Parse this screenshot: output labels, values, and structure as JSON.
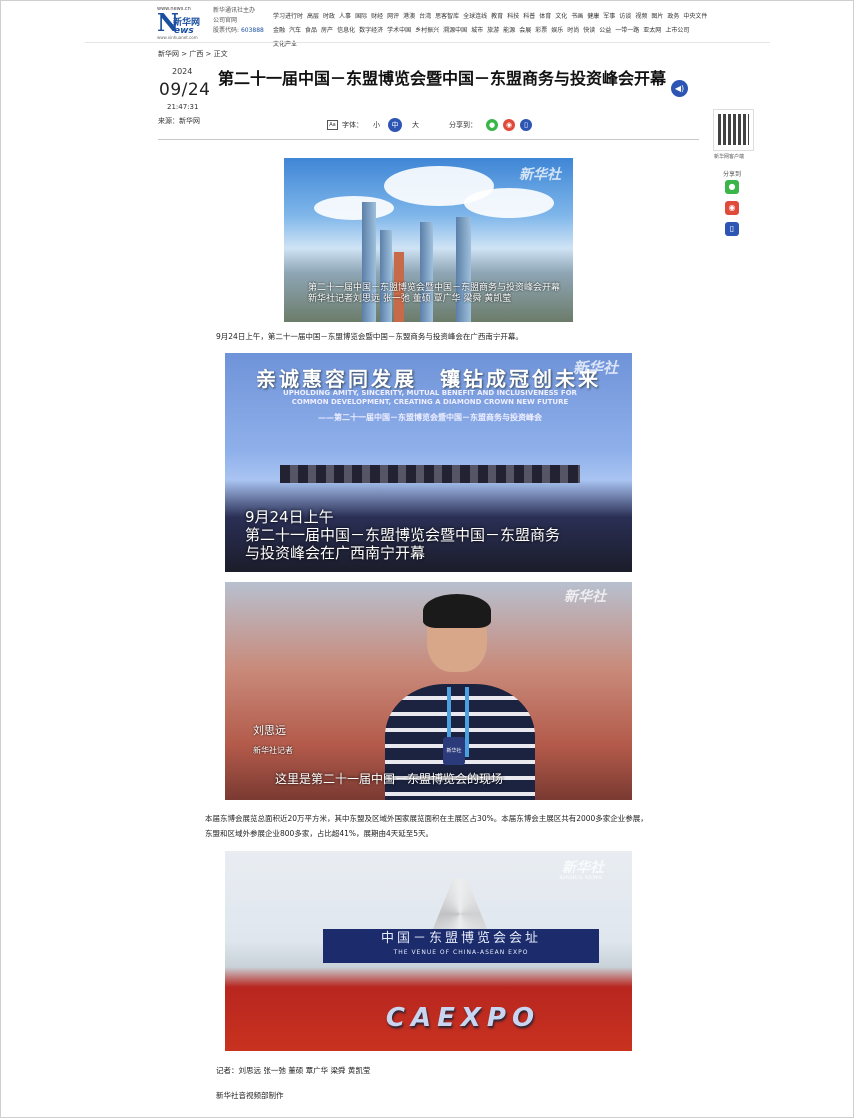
{
  "header": {
    "logo": {
      "url": "www.news.cn",
      "brand_cn": "新华网",
      "brand_en": "ews",
      "sub": "www.xinhuanet.com"
    },
    "owner_line1": "新华通讯社主办",
    "owner_line2": "公司官网",
    "code_label": "股票代码: ",
    "code": "603888",
    "nav_row1": [
      "学习进行时",
      "高层",
      "时政",
      "人事",
      "国际",
      "财经",
      "网评",
      "港澳",
      "台湾",
      "思客智库",
      "全球连线",
      "教育",
      "科技",
      "科普",
      "体育",
      "文化",
      "书画",
      "健康",
      "军事",
      "访谈",
      "视频",
      "图片",
      "政务",
      "中央文件"
    ],
    "nav_row2": [
      "金融",
      "汽车",
      "食品",
      "房产",
      "信息化",
      "数字经济",
      "学术中国",
      "乡村振兴",
      "溯源中国",
      "城市",
      "旅游",
      "能源",
      "会展",
      "彩票",
      "娱乐",
      "时尚",
      "快读",
      "公益",
      "一带一路",
      "亚太网",
      "上市公司",
      "文化产业"
    ]
  },
  "breadcrumb": "新华网 > 广西 > 正文",
  "meta": {
    "year": "2024",
    "date": "09/24",
    "time": "21:47:31",
    "source": "来源：新华网"
  },
  "article": {
    "title": "第二十一届中国－东盟博览会暨中国－东盟商务与投资峰会开幕",
    "font_label": "字体：",
    "font_sizes": [
      "小",
      "中",
      "大"
    ],
    "share_label": "分享到：",
    "image1": {
      "watermark": "新华社",
      "caption": "第二十一届中国－东盟博览会暨中国－东盟商务与投资峰会开幕 新华社记者刘思远 张一弛 董硕 覃广华 梁舜 黄凯莹"
    },
    "para1": "9月24日上午，第二十一届中国－东盟博览会暨中国－东盟商务与投资峰会在广西南宁开幕。",
    "image2": {
      "banner_cn": "亲诚惠容同发展　镶钻成冠创未来",
      "banner_en": "UPHOLDING AMITY, SINCERITY, MUTUAL BENEFIT AND INCLUSIVENESS FOR COMMON DEVELOPMENT, CREATING A DIAMOND CROWN NEW FUTURE",
      "banner_sub": "——第二十一届中国－东盟博览会暨中国－东盟商务与投资峰会",
      "watermark": "新华社",
      "caption_line1": "9月24日上午",
      "caption_line2": "第二十一届中国－东盟博览会暨中国－东盟商务",
      "caption_line3": "与投资峰会在广西南宁开幕"
    },
    "image3": {
      "watermark": "新华社",
      "reporter_name": "刘思远",
      "reporter_role": "新华社记者",
      "mic_label": "新华社",
      "caption": "这里是第二十一届中国－东盟博览会的现场"
    },
    "para2": "本届东博会展览总面积近20万平方米，其中东盟及区域外国家展览面积在主展区占30%。本届东博会主展区共有2000多家企业参展，东盟和区域外参展企业800多家，占比超41%，展期由4天延至5天。",
    "image4": {
      "watermark": "新华社",
      "watermark_en": "XINHUA NEWS",
      "sign_cn": "中国－东盟博览会会址",
      "sign_en": "THE VENUE OF CHINA-ASEAN EXPO",
      "logo_text": "CAEXPO"
    },
    "credits": "记者：刘思远 张一弛 董硕 覃广华 梁舜 黄凯莹",
    "producer": "新华社音视频部制作"
  },
  "rail": {
    "qr_label": "新华网客户端",
    "share_label": "分享到"
  },
  "colors": {
    "accent": "#2d56b4",
    "wechat": "#3ab54a",
    "weibo": "#e04a3a"
  }
}
